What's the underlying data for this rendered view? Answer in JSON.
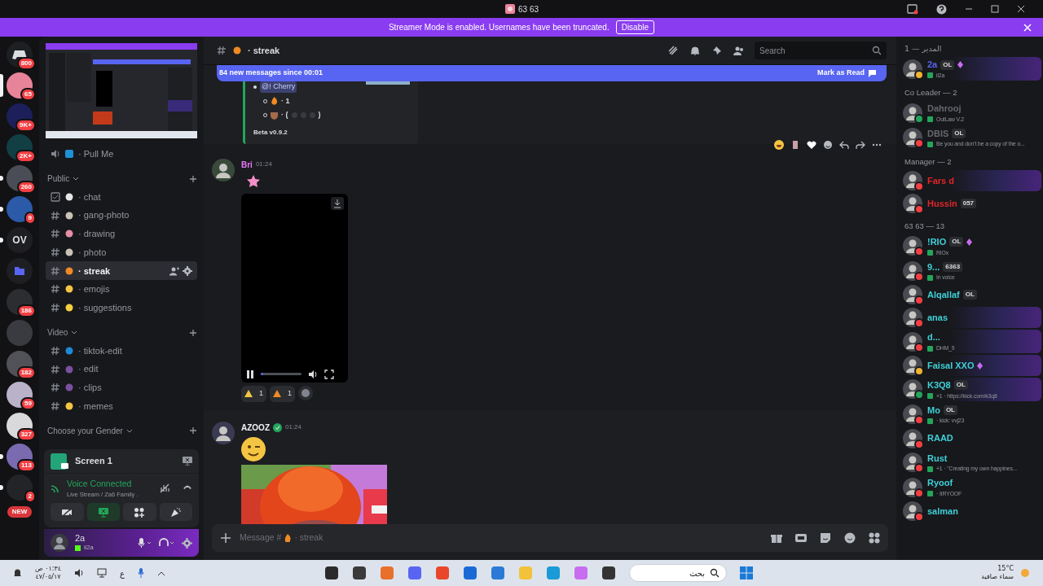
{
  "titlebar": {
    "title": "63 63"
  },
  "banner": {
    "text": "Streamer Mode is enabled. Usernames have been truncated.",
    "button": "Disable"
  },
  "servers": [
    {
      "kind": "home",
      "badge": "800",
      "selected": false,
      "unread": false
    },
    {
      "kind": "avatar",
      "badge": "65",
      "color": "#e8849a",
      "selected": true,
      "unread": false
    },
    {
      "kind": "avatar",
      "badge": "9K+",
      "color": "#1c1f5a",
      "selected": false,
      "unread": false
    },
    {
      "kind": "avatar",
      "badge": "2K+",
      "color": "#113f44",
      "selected": false,
      "unread": false
    },
    {
      "kind": "avatar",
      "badge": "260",
      "color": "#4a4d55",
      "selected": false,
      "unread": true
    },
    {
      "kind": "avatar",
      "badge": "9",
      "color": "#2a5aa8",
      "selected": false,
      "unread": true
    },
    {
      "kind": "text",
      "label": "OV",
      "selected": false,
      "unread": true
    },
    {
      "kind": "folder",
      "selected": false,
      "unread": false
    },
    {
      "kind": "avatar",
      "badge": "186",
      "color": "#2b2d31",
      "selected": false,
      "unread": false
    },
    {
      "kind": "avatar",
      "color": "#3a3b40",
      "selected": false,
      "unread": false
    },
    {
      "kind": "avatar",
      "badge": "182",
      "color": "#505258",
      "selected": false,
      "unread": false
    },
    {
      "kind": "avatar",
      "badge": "59",
      "color": "#b9b2c8",
      "selected": false,
      "unread": false
    },
    {
      "kind": "avatar",
      "badge": "327",
      "color": "#d9d9dc",
      "selected": false,
      "unread": false
    },
    {
      "kind": "avatar",
      "badge": "113",
      "color": "#7a6ab0",
      "selected": false,
      "unread": true
    },
    {
      "kind": "avatar",
      "badge": "2",
      "color": "#232428",
      "selected": false,
      "unread": true
    },
    {
      "kind": "new",
      "badge": "NEW",
      "selected": false,
      "unread": false
    }
  ],
  "voice_channels": [
    {
      "name": "· Pull Me",
      "color": "#1e90d6"
    }
  ],
  "categories": [
    {
      "name": "Public",
      "channels": [
        {
          "kind": "forum",
          "name": "· chat",
          "color": "#e6e6e6",
          "selected": false
        },
        {
          "kind": "text",
          "name": "· gang-photo",
          "color": "#c9c2b5",
          "selected": false
        },
        {
          "kind": "text",
          "name": "· drawing",
          "color": "#e48fa6",
          "selected": false
        },
        {
          "kind": "text",
          "name": "· photo",
          "color": "#c9c2b5",
          "selected": false
        },
        {
          "kind": "text",
          "name": "· streak",
          "color": "#f08a24",
          "selected": true
        },
        {
          "kind": "text",
          "name": "· emojis",
          "color": "#f4c542",
          "selected": false
        },
        {
          "kind": "text",
          "name": "· suggestions",
          "color": "#f4d03f",
          "selected": false
        }
      ]
    },
    {
      "name": "Video",
      "channels": [
        {
          "kind": "text",
          "name": "· tiktok-edit",
          "color": "#1e8ad6",
          "selected": false
        },
        {
          "kind": "text",
          "name": "· edit",
          "color": "#7a4fa0",
          "selected": false
        },
        {
          "kind": "text",
          "name": "· clips",
          "color": "#7a4fa0",
          "selected": false
        },
        {
          "kind": "text",
          "name": "· memes",
          "color": "#f4c542",
          "selected": false
        }
      ]
    },
    {
      "name": "Choose your Gender"
    }
  ],
  "stream": {
    "title": "Screen 1"
  },
  "voice": {
    "status": "Voice Connected",
    "channel": "Live Stream / Za6 Family ."
  },
  "user": {
    "name": "2a",
    "status_text": "ii2a"
  },
  "chat": {
    "channel": "· streak",
    "search_placeholder": "Search",
    "new_messages": {
      "text": "84 new messages since 00:01",
      "action": "Mark as Read"
    },
    "embed": {
      "mention": "@! Cherry",
      "items": [
        {
          "text": "· 1"
        },
        {
          "text": "· (",
          "suffix": ")"
        }
      ],
      "footer": "Beta v0.9.2"
    },
    "messages": [
      {
        "kind": "video",
        "author": "Bri",
        "color": "#e879f9",
        "time": "01:24",
        "level": 0.05,
        "reactions": [
          {
            "count": "1",
            "color": "#f4c542"
          },
          {
            "count": "1",
            "color": "#f08a24"
          }
        ]
      },
      {
        "author": "AZOOZ",
        "color": "#f2f3f5",
        "time": "01:24"
      }
    ],
    "composer": {
      "prefix": "Message #",
      "channel": "· streak"
    }
  },
  "members": {
    "groups": [
      {
        "title": "المدير — 1",
        "color": "#5865f2",
        "members": [
          {
            "kind": "banner",
            "name": "2a",
            "color": "#f0b232",
            "tags": [
              "OL"
            ],
            "boost": true,
            "activity": "ii2a"
          }
        ]
      },
      {
        "title": "Co Leader — 2",
        "color": "#65676e",
        "members": [
          {
            "kind": "plain",
            "name": "Dahrooj",
            "color": "#23a55a",
            "boost": false,
            "activity": "OutLaw V.2"
          },
          {
            "kind": "plain",
            "name": "DBIS",
            "color": "#f23f43",
            "tags": [
              "OL"
            ],
            "boost": false,
            "activity": "Be you and don't be a copy of the o..."
          }
        ]
      },
      {
        "title": "Manager — 2",
        "color": "#e0262b",
        "members": [
          {
            "kind": "banner",
            "name": "Fars d",
            "color": "#f23f43",
            "boost": false
          },
          {
            "kind": "plain",
            "name": "Hussin",
            "color": "#f23f43",
            "tags": [
              "057"
            ],
            "boost": false
          }
        ]
      },
      {
        "title": "63 63 — 13",
        "color": "#3fd0d8",
        "members": [
          {
            "kind": "plain",
            "name": "!RIO",
            "color": "#f23f43",
            "tags": [
              "OL"
            ],
            "boost": true,
            "activity": "RIOx"
          },
          {
            "kind": "plain",
            "name": "9...",
            "color": "#f23f43",
            "tags": [
              "6363"
            ],
            "boost": false,
            "activity": "In voice"
          },
          {
            "kind": "plain",
            "name": "Alqallaf",
            "color": "#f23f43",
            "tags": [
              "OL"
            ],
            "boost": false
          },
          {
            "kind": "banner",
            "name": "anas",
            "color": "#f23f43",
            "boost": false
          },
          {
            "kind": "banner",
            "name": "d...",
            "color": "#f23f43",
            "boost": false,
            "activity": "DHM_9"
          },
          {
            "kind": "banner",
            "name": "Faisal XXO",
            "color": "#f0b232",
            "boost": true
          },
          {
            "kind": "banner",
            "name": "K3Q8",
            "color": "#23a55a",
            "tags": [
              "OL"
            ],
            "boost": false,
            "activity": "+1 · https://kick.com/k3q8"
          },
          {
            "kind": "plain",
            "name": "Mo",
            "color": "#f23f43",
            "tags": [
              "OL"
            ],
            "boost": false,
            "activity": "· kick: vvj23"
          },
          {
            "kind": "plain",
            "name": "RAAD",
            "color": "#f23f43",
            "boost": false
          },
          {
            "kind": "plain",
            "name": "Rust",
            "color": "#f23f43",
            "boost": false,
            "activity": "+1 · \"Creating my own happines..."
          },
          {
            "kind": "plain",
            "name": "Ryoof",
            "color": "#f23f43",
            "boost": false,
            "activity": "· IIRYOOF"
          },
          {
            "kind": "plain",
            "name": "salman",
            "color": "#f23f43",
            "boost": false
          }
        ]
      }
    ]
  },
  "taskbar": {
    "time": "٠١:٣٤ ص",
    "date": "٤٧/٠٥/١٧",
    "language": "ع",
    "search": "بحث",
    "temperature": "15°C",
    "weather": "سماء صافية"
  }
}
